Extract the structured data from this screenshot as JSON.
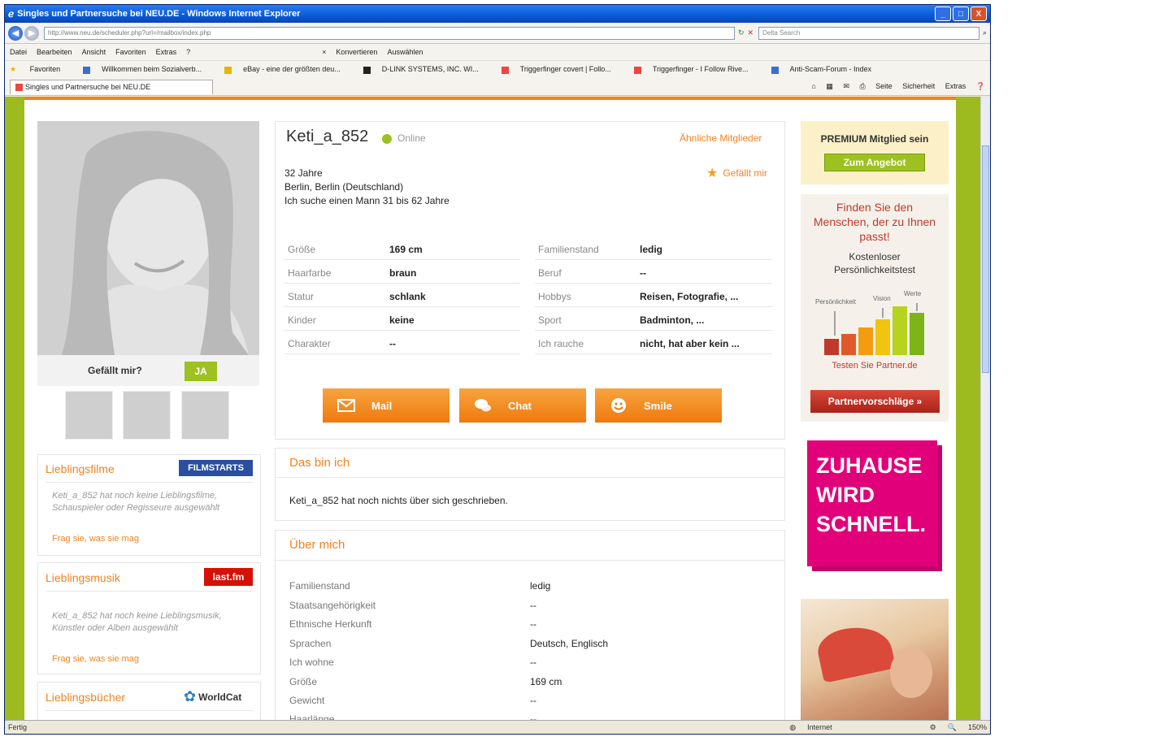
{
  "window": {
    "title": "Singles und Partnersuche bei NEU.DE - Windows Internet Explorer",
    "controls": [
      "_",
      "□",
      "X"
    ]
  },
  "browser": {
    "address": "http://www.neu.de/scheduler.php?url=/mailbox/index.php",
    "search_placeholder": "Delta Search",
    "menu": [
      "Datei",
      "Bearbeiten",
      "Ansicht",
      "Favoriten",
      "Extras",
      "?"
    ],
    "toolbar_extra": [
      "Konvertieren",
      "Auswählen"
    ],
    "favorites_label": "Favoriten",
    "favorites": [
      "Willkommen beim Sozialverb...",
      "eBay - eine der größten deu...",
      "D-LINK SYSTEMS, INC. WI...",
      "Triggerfinger covert | Follo...",
      "Triggerfinger - I Follow Rive...",
      "Anti-Scam-Forum - Index"
    ],
    "tab_title": "Singles und Partnersuche bei NEU.DE",
    "tools": [
      "Seite",
      "Sicherheit",
      "Extras"
    ],
    "status": {
      "left": "Fertig",
      "zone": "Internet",
      "zoom": "150%"
    }
  },
  "profile": {
    "username": "Keti_a_852",
    "online_label": "Online",
    "similar_link": "Ähnliche Mitglieder",
    "like_link": "Gefällt mir",
    "age": "32 Jahre",
    "location": "Berlin, Berlin (Deutschland)",
    "search": "Ich suche einen Mann 31 bis 62 Jahre",
    "like_question": "Gefällt mir?",
    "like_button": "JA",
    "attributes_left": [
      {
        "label": "Größe",
        "value": "169 cm"
      },
      {
        "label": "Haarfarbe",
        "value": "braun"
      },
      {
        "label": "Statur",
        "value": "schlank"
      },
      {
        "label": "Kinder",
        "value": "keine"
      },
      {
        "label": "Charakter",
        "value": "--"
      }
    ],
    "attributes_right": [
      {
        "label": "Familienstand",
        "value": "ledig"
      },
      {
        "label": "Beruf",
        "value": "--"
      },
      {
        "label": "Hobbys",
        "value": "Reisen, Fotografie, ..."
      },
      {
        "label": "Sport",
        "value": "Badminton, ..."
      },
      {
        "label": "Ich rauche",
        "value": "nicht, hat aber kein ..."
      }
    ],
    "actions": [
      "Mail",
      "Chat",
      "Smile"
    ]
  },
  "das_bin_ich": {
    "title": "Das bin ich",
    "text": "Keti_a_852 hat noch nichts über sich geschrieben."
  },
  "ueber_mich": {
    "title": "Über mich",
    "rows": [
      {
        "label": "Familienstand",
        "value": "ledig"
      },
      {
        "label": "Staatsangehörigkeit",
        "value": "--"
      },
      {
        "label": "Ethnische Herkunft",
        "value": "--"
      },
      {
        "label": "Sprachen",
        "value": "Deutsch, Englisch"
      },
      {
        "label": "Ich wohne",
        "value": "--"
      },
      {
        "label": "Größe",
        "value": "169 cm"
      },
      {
        "label": "Gewicht",
        "value": "--"
      },
      {
        "label": "Haarlänge",
        "value": "--"
      }
    ]
  },
  "left_sections": {
    "filme": {
      "title": "Lieblingsfilme",
      "logo": "FILMSTARTS",
      "text": "Keti_a_852 hat noch keine Lieblingsfilme, Schauspieler oder Regisseure ausgewählt",
      "link": "Frag sie, was sie mag"
    },
    "musik": {
      "title": "Lieblingsmusik",
      "logo": "last.fm",
      "text": "Keti_a_852 hat noch keine Lieblingsmusik, Künstler oder Alben ausgewählt",
      "link": "Frag sie, was sie mag"
    },
    "buecher": {
      "title": "Lieblingsbücher",
      "logo": "WorldCat"
    }
  },
  "sidebar": {
    "premium_title": "PREMIUM Mitglied sein",
    "premium_button": "Zum Angebot",
    "test_headline": "Finden Sie den Menschen, der zu Ihnen passt!",
    "test_sub": "Kostenloser Persönlichkeitstest",
    "chart_labels": [
      "Persönlichkeit",
      "Vision",
      "Werte"
    ],
    "test_link": "Testen Sie Partner.de",
    "partner_button": "Partnervorschläge »",
    "ad_text": "ZUHAUSE WIRD SCHNELL."
  },
  "colors": {
    "accent": "#f3821f",
    "page_bg": "#9dbb1e",
    "online": "#9dc11f",
    "ad_pink": "#e2007a"
  }
}
